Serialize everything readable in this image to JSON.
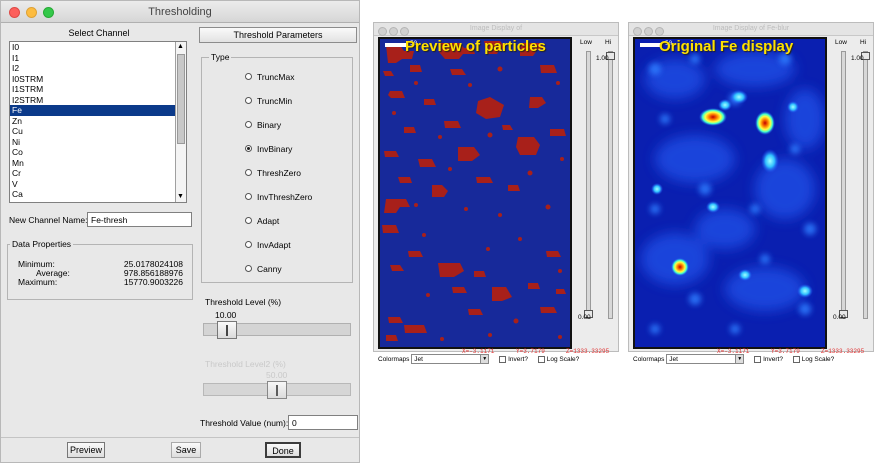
{
  "thresholding": {
    "title": "Thresholding",
    "select_channel_label": "Select Channel",
    "threshold_params_label": "Threshold Parameters",
    "channels": [
      "I0",
      "I1",
      "I2",
      "I0STRM",
      "I1STRM",
      "I2STRM",
      "Fe",
      "Zn",
      "Cu",
      "Ni",
      "Co",
      "Mn",
      "Cr",
      "V",
      "Ca"
    ],
    "selected_channel": "Fe",
    "new_channel_label": "New Channel Name:",
    "new_channel_value": "Fe-thresh",
    "data_properties": {
      "title": "Data Properties",
      "minimum_label": "Minimum:",
      "minimum_value": "25.0178024108",
      "average_label": "Average:",
      "average_value": "978.856188976",
      "maximum_label": "Maximum:",
      "maximum_value": "15770.9003226"
    },
    "type_group_title": "Type",
    "types": [
      "TruncMax",
      "TruncMin",
      "Binary",
      "InvBinary",
      "ThreshZero",
      "InvThreshZero",
      "Adapt",
      "InvAdapt",
      "Canny"
    ],
    "selected_type": "InvBinary",
    "threshold_level_label": "Threshold Level (%)",
    "threshold_level_value": "10.00",
    "threshold_level2_label": "Threshold Level2 (%)",
    "threshold_level2_value": "50.00",
    "threshold_value_label": "Threshold Value (num):",
    "threshold_value": "0",
    "buttons": {
      "preview": "Preview",
      "save": "Save",
      "done": "Done"
    }
  },
  "display_left": {
    "title": "Image Display of",
    "overlay_text": "Preview of particles",
    "scale_label": "50",
    "low_label": "Low",
    "hi_label": "Hi",
    "hi_value": "1.00",
    "low_value": "0.00",
    "colormaps_label": "Colormaps",
    "colormap_value": "Jet",
    "invert_label": "Invert?",
    "log_scale_label": "Log Scale?",
    "x_readout": "X=-3.1171",
    "y_readout": "Y=3.7179",
    "z_readout": "Z=1333.33295"
  },
  "display_right": {
    "title": "Image Display of Fe-blur",
    "overlay_text": "Original Fe display",
    "scale_label": "50",
    "low_label": "Low",
    "hi_label": "Hi",
    "hi_value": "1.00",
    "low_value": "0.00",
    "colormaps_label": "Colormaps",
    "colormap_value": "Jet",
    "invert_label": "Invert?",
    "log_scale_label": "Log Scale?",
    "x_readout": "X=-3.1171",
    "y_readout": "Y=3.7179",
    "z_readout": "Z=1333.33295"
  },
  "colors": {
    "particle_red": "#a8201a",
    "map_blue": "#17299a",
    "selection_blue": "#0b3a8a",
    "readout_red": "#e03030",
    "overlay_yellow": "#ffe100"
  }
}
